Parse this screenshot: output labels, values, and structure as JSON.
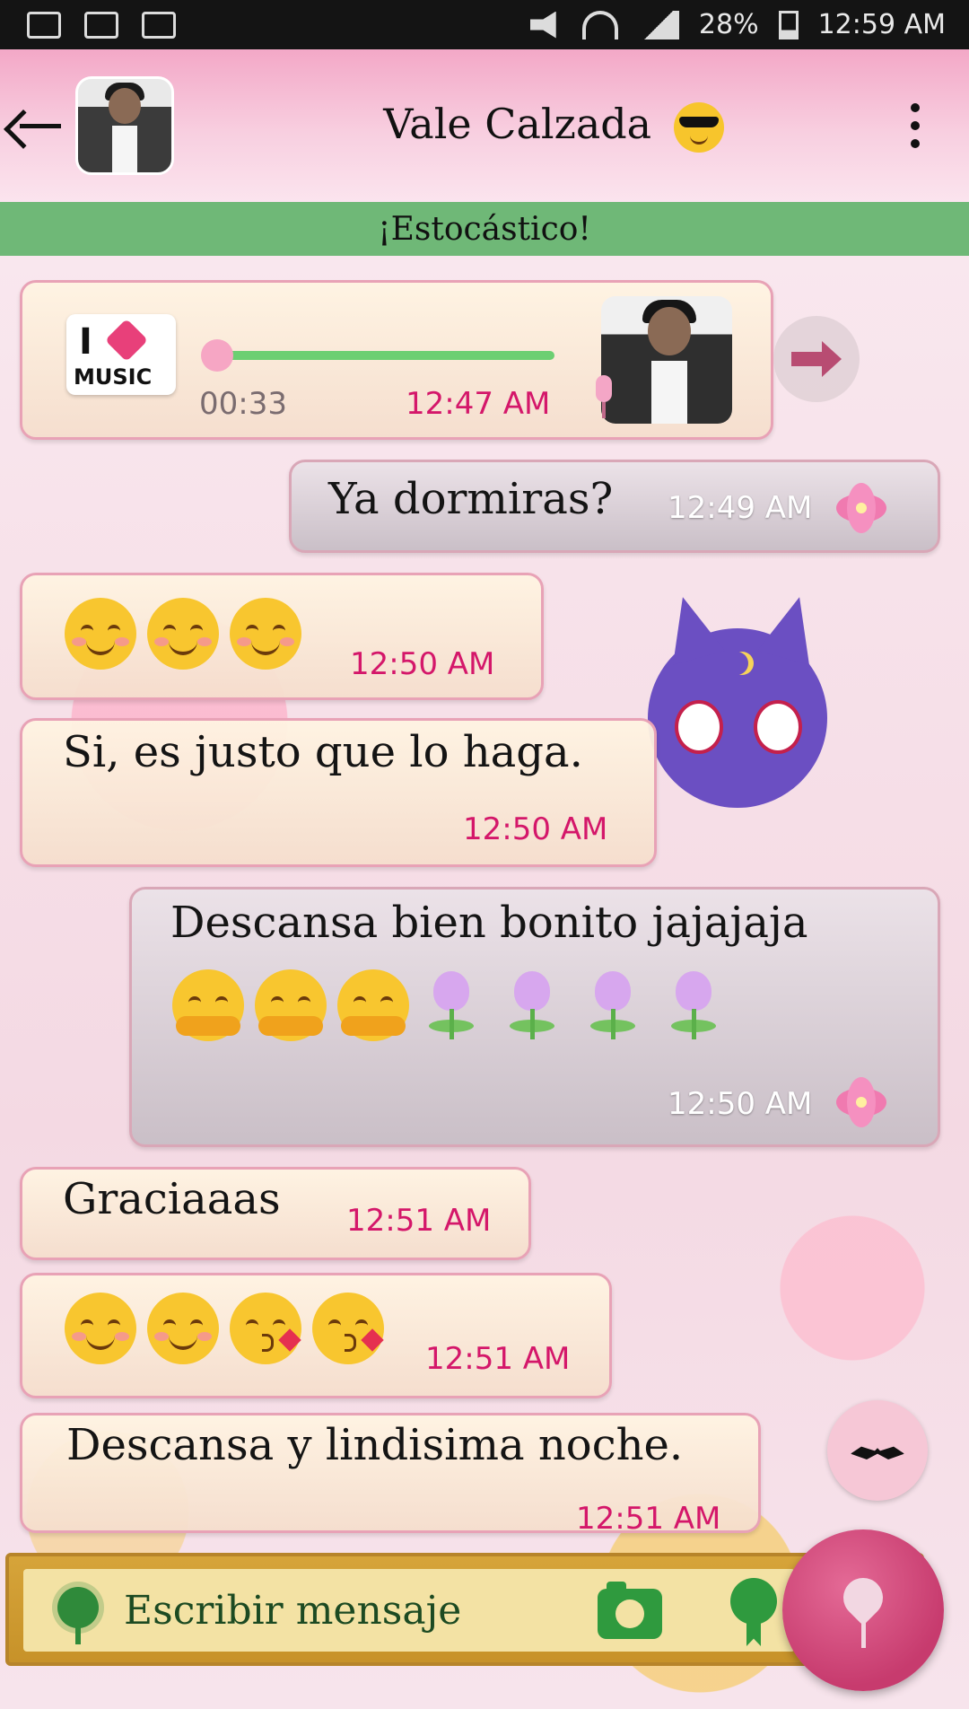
{
  "status_bar": {
    "battery": "28%",
    "time": "12:59 AM"
  },
  "header": {
    "title": "Vale Calzada",
    "title_icon": "sunglasses-emoji-icon"
  },
  "subheader": {
    "status": "¡Estocástico!"
  },
  "messages": [
    {
      "type": "voice",
      "direction": "in",
      "duration": "00:33",
      "time": "12:47 AM",
      "progress": 0.0
    },
    {
      "type": "text",
      "direction": "out",
      "text": "Ya dormiras?",
      "time": "12:49 AM"
    },
    {
      "type": "emoji",
      "direction": "in",
      "emojis": [
        "smiling-face",
        "smiling-face",
        "smiling-face"
      ],
      "time": "12:50 AM"
    },
    {
      "type": "text",
      "direction": "in",
      "text": "Si, es justo que lo haga.",
      "time": "12:50 AM"
    },
    {
      "type": "text",
      "direction": "out",
      "text": "Descansa bien bonito jajajaja",
      "emojis": [
        "hugging-face",
        "hugging-face",
        "hugging-face",
        "tulip",
        "tulip",
        "tulip",
        "tulip"
      ],
      "time": "12:50 AM"
    },
    {
      "type": "text",
      "direction": "in",
      "text": "Graciaaas",
      "time": "12:51 AM"
    },
    {
      "type": "emoji",
      "direction": "in",
      "emojis": [
        "smiling-face",
        "smiling-face",
        "kissing-face",
        "kissing-face"
      ],
      "time": "12:51 AM"
    },
    {
      "type": "text",
      "direction": "in",
      "text": "Descansa y lindisima noche.",
      "time": "12:51 AM"
    }
  ],
  "input": {
    "placeholder": "Escribir mensaje",
    "value": ""
  },
  "colors": {
    "accent_pink": "#d4176a",
    "subheader_green": "#6fb877",
    "input_bar": "#c79229",
    "send_button": "#c73b6e"
  }
}
